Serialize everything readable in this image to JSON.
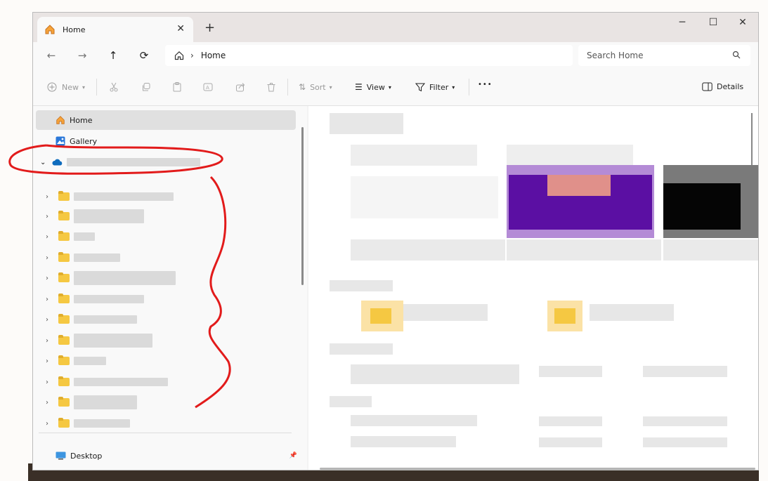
{
  "window": {
    "tab_title": "Home",
    "tab_close": "✕",
    "new_tab": "+",
    "minimize": "─",
    "maximize": "☐",
    "close": "✕"
  },
  "nav": {
    "back": "←",
    "forward": "→",
    "up": "↑",
    "refresh": "⟳",
    "breadcrumb_sep": "›",
    "breadcrumb": "Home",
    "search_placeholder": "Search Home"
  },
  "commands": {
    "new_label": "New",
    "sort_label": "Sort",
    "view_label": "View",
    "filter_label": "Filter",
    "more": "•••",
    "details_label": "Details"
  },
  "sidebar": {
    "home": "Home",
    "gallery": "Gallery",
    "desktop": "Desktop",
    "pin": "📌",
    "expand": "⌄",
    "collapsed": "›"
  },
  "colors": {
    "accent": "#0067c0",
    "folder": "#f5c842",
    "annotation": "#e21b1b"
  }
}
